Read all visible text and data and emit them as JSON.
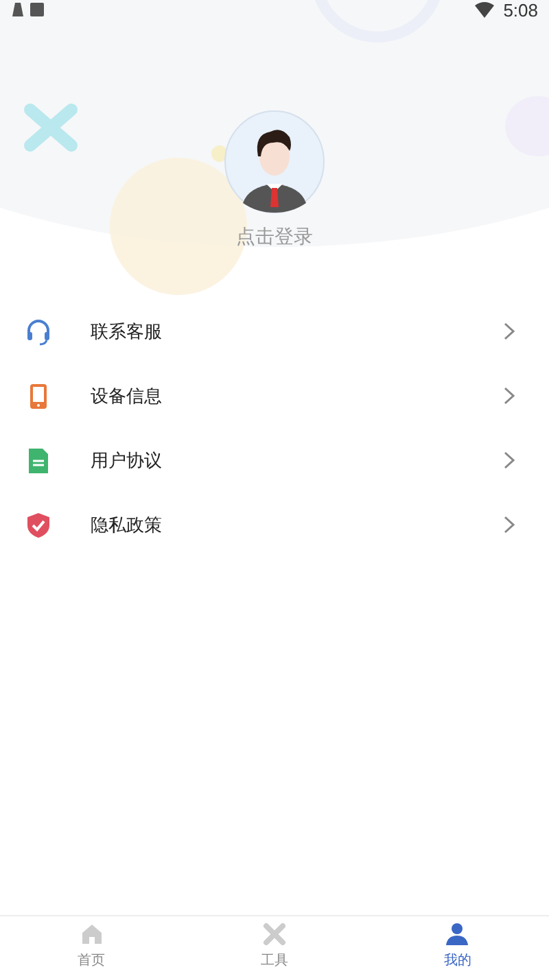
{
  "status_bar": {
    "time": "5:08"
  },
  "profile": {
    "login_label": "点击登录"
  },
  "menu": [
    {
      "label": "联系客服",
      "kind": "headset"
    },
    {
      "label": "设备信息",
      "kind": "phone"
    },
    {
      "label": "用户协议",
      "kind": "document"
    },
    {
      "label": "隐私政策",
      "kind": "shield"
    }
  ],
  "tab_bar": [
    {
      "label": "首页",
      "kind": "home",
      "selected": false
    },
    {
      "label": "工具",
      "kind": "tools",
      "selected": false
    },
    {
      "label": "我的",
      "kind": "person",
      "selected": true
    }
  ]
}
